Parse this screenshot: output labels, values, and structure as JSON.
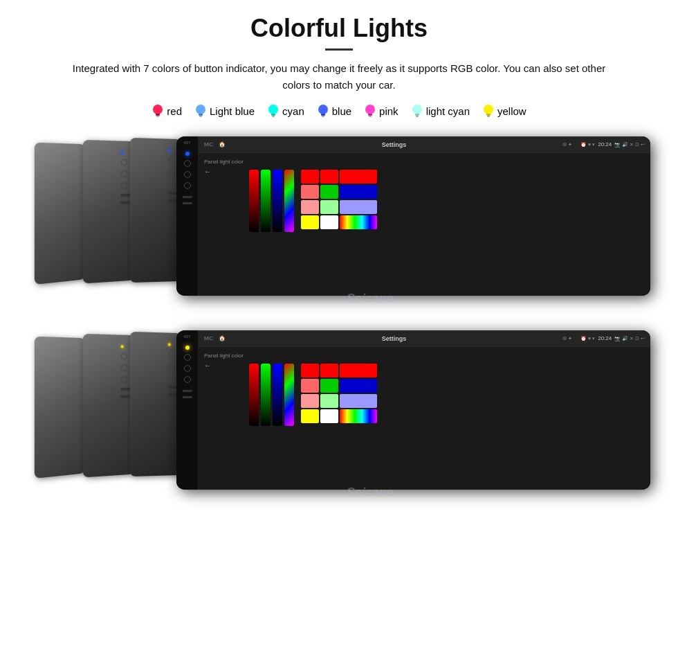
{
  "header": {
    "title": "Colorful Lights",
    "description": "Integrated with 7 colors of button indicator, you may change it freely as it supports RGB color. You can also set other colors to match your car."
  },
  "colors": [
    {
      "name": "red",
      "hex": "#ff0040",
      "bulb_color": "#ff2255"
    },
    {
      "name": "Light blue",
      "hex": "#66aaff",
      "bulb_color": "#66aaff"
    },
    {
      "name": "cyan",
      "hex": "#00ffee",
      "bulb_color": "#00ffee"
    },
    {
      "name": "blue",
      "hex": "#2255ff",
      "bulb_color": "#4466ff"
    },
    {
      "name": "pink",
      "hex": "#ff44cc",
      "bulb_color": "#ff44cc"
    },
    {
      "name": "light cyan",
      "hex": "#aaffee",
      "bulb_color": "#aaffee"
    },
    {
      "name": "yellow",
      "hex": "#ffee00",
      "bulb_color": "#ffee00"
    }
  ],
  "device_rows": [
    {
      "id": "row1",
      "button_colors": [
        "#2255ff",
        "#2255ff",
        "#2255ff",
        "#2255ff"
      ],
      "watermark": "Seicane"
    },
    {
      "id": "row2",
      "button_colors": [
        "#ffee00",
        "#ffee00",
        "#ffee00",
        "#ffee00"
      ],
      "watermark": "Seicane"
    }
  ],
  "screen": {
    "title": "Settings",
    "time": "20:24",
    "panel_light_label": "Panel light color",
    "color_grid": [
      "#ff0000",
      "#00ff00",
      "#0000ff",
      "#ff0000",
      "#ff6666",
      "#66ff66",
      "#8888ff",
      "#ff4444",
      "#ffaaaa",
      "#aaffaa",
      "#aaaaff",
      "#ffaaaa",
      "#ffff00",
      "#ffffff",
      "#ff00ff",
      "#ffaaff"
    ]
  }
}
